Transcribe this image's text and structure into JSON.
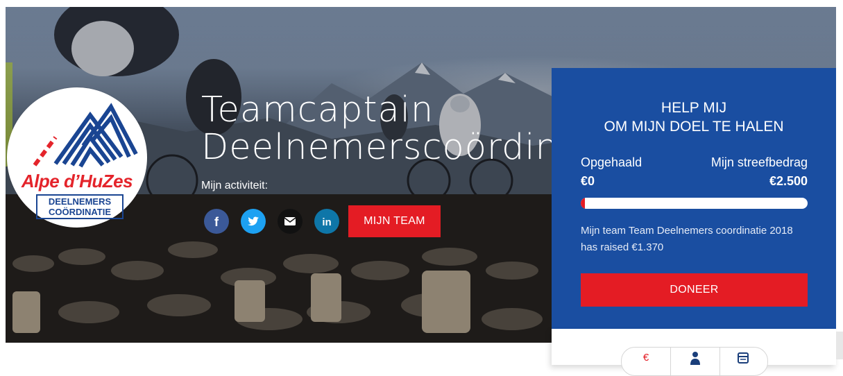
{
  "hero": {
    "title_line1": "Teamcaptain",
    "title_line2": "Deelnemerscoördinatie",
    "activity_label": "Mijn activiteit:",
    "team_button": "MIJN TEAM"
  },
  "logo": {
    "name": "Alpe d’HuZes",
    "sub_line1": "DEELNEMERS",
    "sub_line2": "COÖRDINATIE"
  },
  "social": [
    {
      "icon": "facebook-icon",
      "glyph": "f",
      "color": "#3b5998"
    },
    {
      "icon": "twitter-icon",
      "color": "#1da1f2"
    },
    {
      "icon": "email-icon",
      "color": "#111111"
    },
    {
      "icon": "linkedin-icon",
      "glyph": "in",
      "color": "#0e76a8"
    }
  ],
  "donation": {
    "heading_line1": "HELP MIJ",
    "heading_line2": "OM MIJN DOEL TE HALEN",
    "raised_label": "Opgehaald",
    "raised_value": "€0",
    "goal_label": "Mijn streefbedrag",
    "goal_value": "€2.500",
    "progress_fraction": 0.0,
    "team_text": "Mijn team Team Deelnemers coordinatie 2018 has raised €1.370",
    "donate_button": "DONEER"
  },
  "tabs": [
    {
      "icon": "euro-icon",
      "glyph": "€"
    },
    {
      "icon": "person-icon"
    },
    {
      "icon": "calendar-icon"
    }
  ],
  "colors": {
    "accent_red": "#e41c24",
    "panel_blue": "#1a4ea1",
    "logo_blue": "#1a4592"
  }
}
